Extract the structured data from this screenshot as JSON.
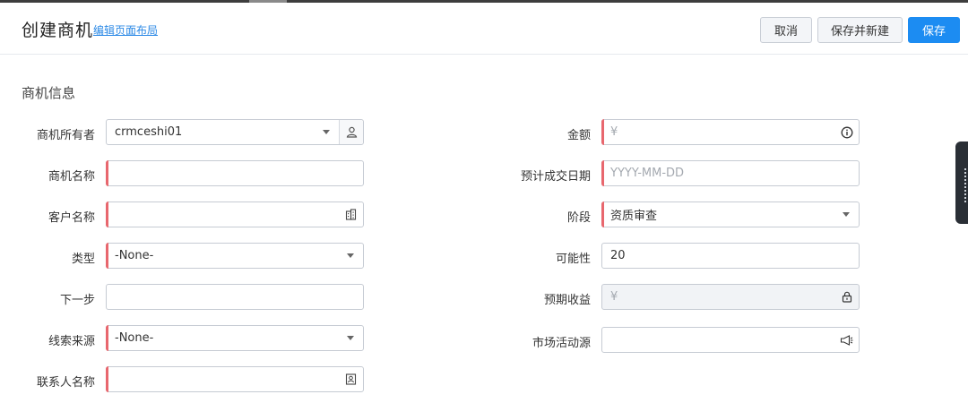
{
  "header": {
    "title": "创建商机",
    "edit_layout_link": "编辑页面布局",
    "cancel_label": "取消",
    "save_new_label": "保存并新建",
    "save_label": "保存"
  },
  "section": {
    "title": "商机信息"
  },
  "left_fields": {
    "owner": {
      "label": "商机所有者",
      "value": "crmceshi01"
    },
    "opportunity_name": {
      "label": "商机名称",
      "value": ""
    },
    "customer_name": {
      "label": "客户名称",
      "value": ""
    },
    "type": {
      "label": "类型",
      "value": "-None-"
    },
    "next_step": {
      "label": "下一步",
      "value": ""
    },
    "lead_source": {
      "label": "线索来源",
      "value": "-None-"
    },
    "contact_name": {
      "label": "联系人名称",
      "value": ""
    }
  },
  "right_fields": {
    "amount": {
      "label": "金额",
      "prefix": "¥"
    },
    "close_date": {
      "label": "预计成交日期",
      "placeholder": "YYYY-MM-DD"
    },
    "stage": {
      "label": "阶段",
      "value": "资质审查"
    },
    "probability": {
      "label": "可能性",
      "value": "20"
    },
    "expected_revenue": {
      "label": "预期收益",
      "prefix": "¥"
    },
    "campaign_source": {
      "label": "市场活动源",
      "value": ""
    }
  },
  "colors": {
    "primary": "#1c8cf2",
    "required_marker": "#e8676e",
    "link": "#2d8ae6"
  },
  "icons": {
    "owner_lookup": "person-icon",
    "customer_lookup": "building-icon",
    "amount_info": "info-icon",
    "expected_revenue_lock": "lock-icon",
    "campaign_lookup": "megaphone-icon",
    "contact_lookup": "contact-card-icon"
  }
}
